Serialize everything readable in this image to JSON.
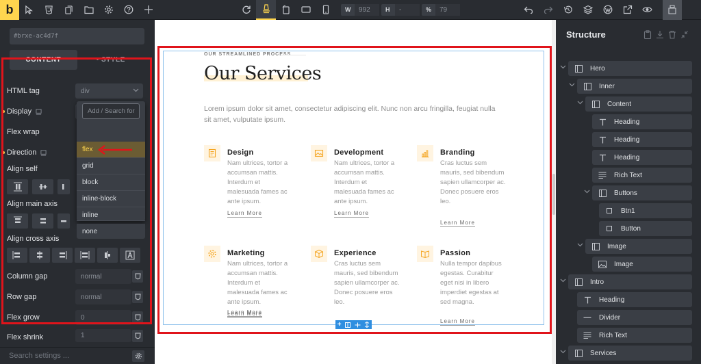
{
  "toolbar": {
    "logo": "b",
    "width_label": "W",
    "width_value": "992",
    "height_label": "H",
    "height_value": "-",
    "zoom_label": "%",
    "zoom_value": "79",
    "accent_color": "#ffd64f"
  },
  "left_panel": {
    "element_id": "#brxe-ac4d7f",
    "tabs": [
      {
        "label": "CONTENT",
        "active": true
      },
      {
        "label": "• STYLE",
        "active": false
      }
    ],
    "settings": {
      "html_tag": {
        "label": "HTML tag",
        "value": "div"
      },
      "display": {
        "label": "Display",
        "value": "flex"
      },
      "flex_wrap": {
        "label": "Flex wrap"
      },
      "direction": {
        "label": "Direction"
      },
      "align_self": {
        "label": "Align self"
      },
      "align_main_axis": {
        "label": "Align main axis"
      },
      "align_cross_axis": {
        "label": "Align cross axis"
      },
      "column_gap": {
        "label": "Column gap",
        "placeholder": "normal"
      },
      "row_gap": {
        "label": "Row gap",
        "placeholder": "normal"
      },
      "flex_grow": {
        "label": "Flex grow",
        "placeholder": "0"
      },
      "flex_shrink": {
        "label": "Flex shrink",
        "placeholder": "1"
      }
    },
    "display_dropdown": {
      "search_placeholder": "Add / Search for",
      "options": [
        "flex",
        "grid",
        "block",
        "inline-block",
        "inline",
        "none"
      ],
      "selected": "flex"
    },
    "search_settings_placeholder": "Search settings ..."
  },
  "canvas": {
    "eyebrow": "OUR STREAMLINED PROCESS",
    "title": "Our Services",
    "lead": "Lorem ipsum dolor sit amet, consectetur adipiscing elit. Nunc non arcu fringilla, feugiat nulla sit amet, vulputate ipsum.",
    "services": [
      {
        "name": "Design",
        "text": "Nam ultrices, tortor a accumsan mattis. Interdum et malesuada fames ac ante ipsum.",
        "link": "Learn More",
        "icon": "document-icon"
      },
      {
        "name": "Development",
        "text": "Nam ultrices, tortor a accumsan mattis. Interdum et malesuada fames ac ante ipsum.",
        "link": "Learn More",
        "icon": "image-icon"
      },
      {
        "name": "Branding",
        "text": "Cras luctus sem mauris, sed bibendum sapien ullamcorper ac. Donec posuere eros leo.",
        "link": "Learn More",
        "icon": "bar-chart-icon"
      },
      {
        "name": "Marketing",
        "text": "Nam ultrices, tortor a accumsan mattis. Interdum et malesuada fames ac ante ipsum.",
        "link": "Learn More",
        "icon": "gear-icon"
      },
      {
        "name": "Experience",
        "text": "Cras luctus sem mauris, sed bibendum sapien ullamcorper ac. Donec posuere eros leo.",
        "link": "Learn More",
        "icon": "box-icon"
      },
      {
        "name": "Passion",
        "text": "Nulla tempor dapibus egestas. Curabitur eget nisi in libero imperdiet egestas at sed magna.",
        "link": "Learn More",
        "icon": "book-icon"
      }
    ],
    "icon_color": "#f5a623"
  },
  "structure": {
    "title": "Structure",
    "nodes": [
      {
        "label": "Hero",
        "icon": "container-icon"
      },
      {
        "label": "Inner",
        "icon": "container-icon"
      },
      {
        "label": "Content",
        "icon": "container-icon"
      },
      {
        "label": "Heading",
        "icon": "text-icon"
      },
      {
        "label": "Heading",
        "icon": "text-icon"
      },
      {
        "label": "Heading",
        "icon": "text-icon"
      },
      {
        "label": "Rich Text",
        "icon": "lines-icon"
      },
      {
        "label": "Buttons",
        "icon": "container-icon"
      },
      {
        "label": "Btn1",
        "icon": "button-icon"
      },
      {
        "label": "Button",
        "icon": "button-icon"
      },
      {
        "label": "Image",
        "icon": "container-icon"
      },
      {
        "label": "Image",
        "icon": "image-icon"
      },
      {
        "label": "Intro",
        "icon": "container-icon"
      },
      {
        "label": "Heading",
        "icon": "text-icon"
      },
      {
        "label": "Divider",
        "icon": "divider-icon"
      },
      {
        "label": "Rich Text",
        "icon": "lines-icon"
      },
      {
        "label": "Services",
        "icon": "container-icon"
      }
    ]
  },
  "annotation": {
    "highlight_color": "#e0141b",
    "arrow_color": "#e0141b"
  }
}
